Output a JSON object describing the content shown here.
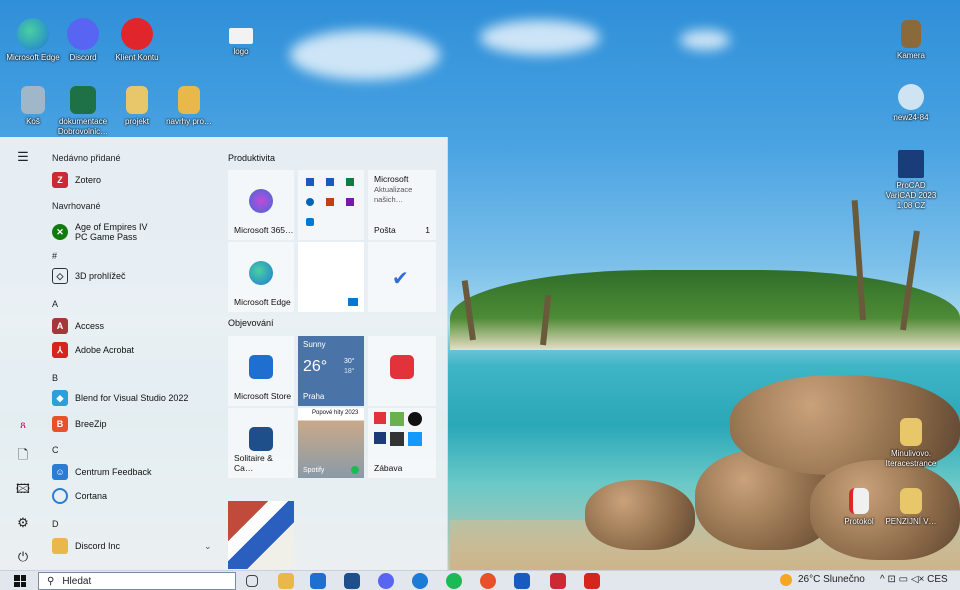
{
  "desktop": {
    "icons": [
      {
        "label": "Microsoft Edge",
        "color": "#1d7ad6"
      },
      {
        "label": "Discord",
        "color": "#5865f2"
      },
      {
        "label": "Klient Kontu",
        "color": "#e0262b"
      },
      {
        "label": "logo",
        "color": "#f2f2f2"
      },
      {
        "label": "Koš",
        "color": "#9fb7c9"
      },
      {
        "label": "dokumentace Dobrovolnic…",
        "color": "#1e7145"
      },
      {
        "label": "projekt",
        "color": "#e8c66a"
      },
      {
        "label": "navrhy pro…",
        "color": "#e8b84a"
      },
      {
        "label": "Kamera",
        "color": "#8a6a3a"
      },
      {
        "label": "new24-84",
        "color": "#cfe4f3"
      },
      {
        "label": "ProCAD VariCAD 2023 1.08 CZ",
        "color": "#1a3d7a"
      },
      {
        "label": "Minulivovo. Iteracestrance",
        "color": "#e8c66a"
      },
      {
        "label": "Protokol",
        "color": "#f0f0f0"
      },
      {
        "label": "PENZIJNÍ V…",
        "color": "#e8c66a"
      }
    ]
  },
  "start_menu": {
    "recent_header": "Nedávno přidané",
    "recent_app": "Zotero",
    "suggested_header": "Navrhované",
    "suggested_app": "Age of Empires IV PC Game Pass",
    "suggested_app_line1": "Age of Empires IV",
    "suggested_app_line2": "PC Game Pass",
    "hash_header": "#",
    "app_3d": "3D prohlížeč",
    "letter_a": "A",
    "app_access": "Access",
    "app_acrobat": "Adobe Acrobat",
    "letter_b": "B",
    "app_blend": "Blend for Visual Studio 2022",
    "app_breezip": "BreeZip",
    "letter_c": "C",
    "app_centrum": "Centrum Feedback",
    "app_cortana": "Cortana",
    "letter_d": "D",
    "app_discord": "Discord Inc",
    "productivity_header": "Produktivita",
    "tile_m365": "Microsoft 365…",
    "tile_ms_title": "Microsoft",
    "tile_ms_sub": "Aktualizace našich…",
    "tile_posta": "Pošta",
    "tile_posta_count": "1",
    "tile_edge": "Microsoft Edge",
    "explore_header": "Objevování",
    "tile_store": "Microsoft Store",
    "weather_cond": "Sunny",
    "weather_temp": "26°",
    "weather_hi": "30°",
    "weather_lo": "18°",
    "weather_city": "Praha",
    "tile_solitaire": "Solitaire & Ca…",
    "tile_spotify_title": "Popové hity 2023",
    "tile_spotify": "Spotify",
    "tile_zabava": "Zábava"
  },
  "taskbar": {
    "search_placeholder": "Hledat",
    "weather": "26°C Slunečno",
    "tray_tail": "^ ⊡ ▭ ◁× CES"
  },
  "colors": {
    "accent": "#0078d4",
    "start_bg": "#ecf0f4"
  }
}
